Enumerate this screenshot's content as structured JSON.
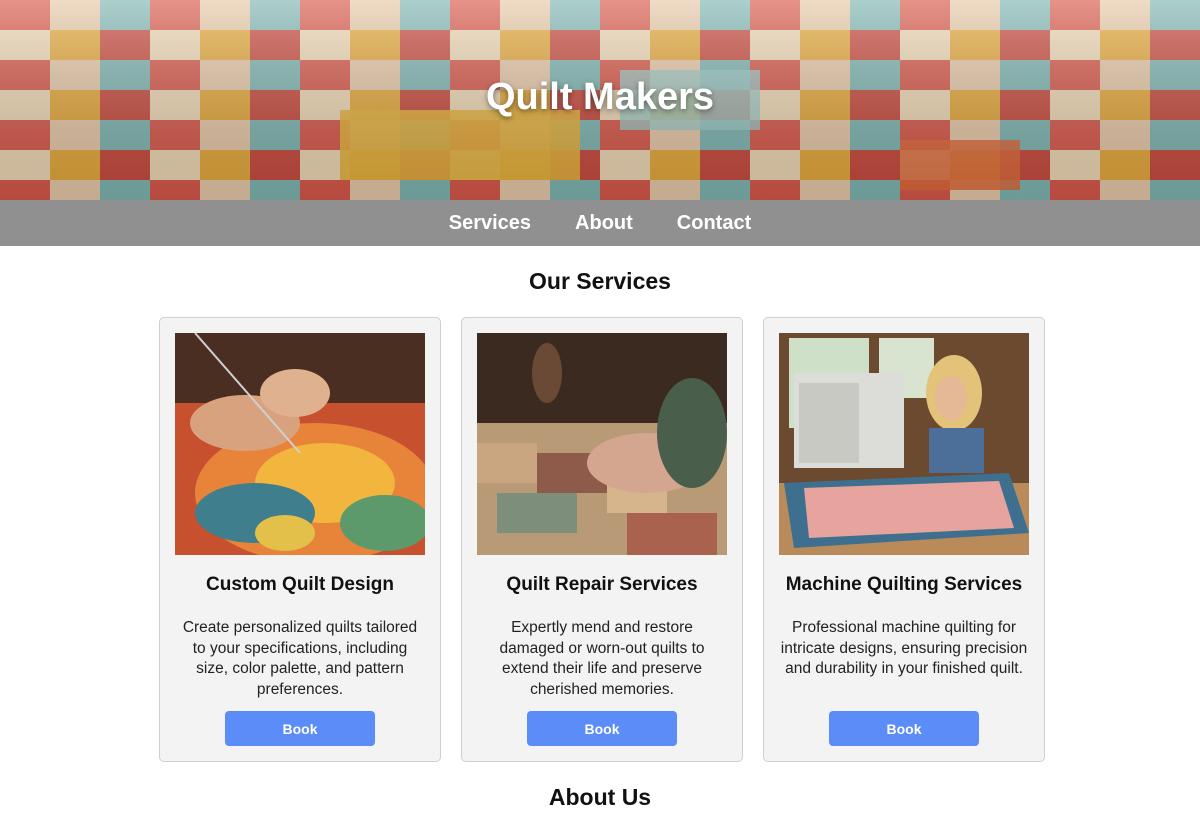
{
  "header": {
    "title": "Quilt Makers",
    "hero_image": "patchwork-quilt-photo"
  },
  "nav": {
    "items": [
      {
        "label": "Services"
      },
      {
        "label": "About"
      },
      {
        "label": "Contact"
      }
    ]
  },
  "services": {
    "title": "Our Services",
    "cards": [
      {
        "title": "Custom Quilt Design",
        "description": "Create personalized quilts tailored to your specifications, including size, color palette, and pattern preferences.",
        "button_label": "Book",
        "image": "hands-stitching-quilt-photo"
      },
      {
        "title": "Quilt Repair Services",
        "description": "Expertly mend and restore damaged or worn-out quilts to extend their life and preserve cherished memories.",
        "button_label": "Book",
        "image": "hands-on-old-quilt-photo"
      },
      {
        "title": "Machine Quilting Services",
        "description": "Professional machine quilting for intricate designs, ensuring precision and durability in your finished quilt.",
        "button_label": "Book",
        "image": "woman-at-sewing-machine-photo"
      }
    ]
  },
  "about": {
    "title": "About Us"
  },
  "colors": {
    "nav_background": "#909090",
    "button": "#5b8cf8",
    "card_background": "#f3f3f3"
  }
}
